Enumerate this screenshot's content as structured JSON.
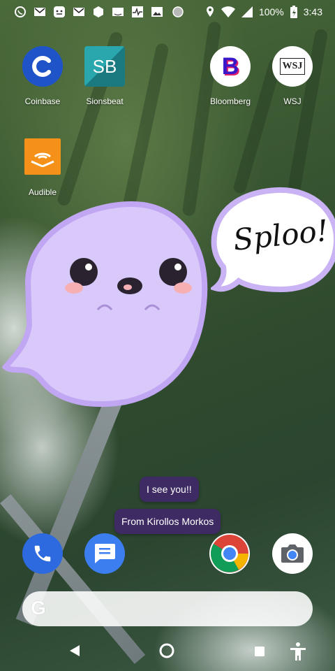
{
  "status_bar": {
    "battery": "100%",
    "time": "3:43",
    "icons": [
      "whatsapp-icon",
      "gmail-icon",
      "messaging-icon",
      "gmail-icon",
      "cube-icon",
      "amazon-icon",
      "pulse-icon",
      "image-icon",
      "circle-icon",
      "location-icon",
      "wifi-icon",
      "signal-icon",
      "battery-charging-icon"
    ]
  },
  "apps": {
    "coinbase": {
      "label": "Coinbase"
    },
    "sionsbeat": {
      "label": "Sionsbeat",
      "glyph": "SB"
    },
    "bloomberg": {
      "label": "Bloomberg",
      "glyph": "B"
    },
    "wsj": {
      "label": "WSJ",
      "glyph": "WSJ"
    },
    "audible": {
      "label": "Audible"
    }
  },
  "overlay": {
    "speech_text": "Sploo!",
    "message": "I see you!!",
    "from": "From Kirollos Morkos"
  },
  "dock": {
    "items": [
      "phone-icon",
      "messages-icon",
      "chrome-icon",
      "camera-icon"
    ]
  },
  "search": {
    "glyph": "G"
  },
  "colors": {
    "ghost": "#d9c8fa",
    "ghost_outline": "#c1a7f3",
    "bubble": "#3f2b63",
    "coinbase": "#1f54c9",
    "sionsbeat": "#1f8d94",
    "audible": "#f59118"
  }
}
